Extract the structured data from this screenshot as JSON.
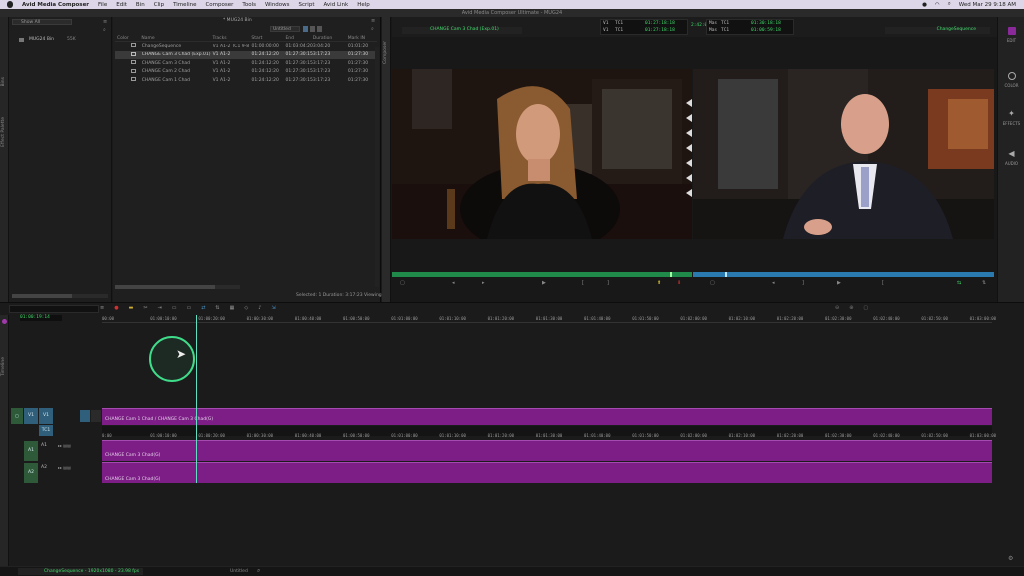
{
  "menubar": {
    "app": "Avid Media Composer",
    "items": [
      "File",
      "Edit",
      "Bin",
      "Clip",
      "Timeline",
      "Composer",
      "Tools",
      "Windows",
      "Script",
      "Avid Link",
      "Help"
    ],
    "clock": "Wed Mar 29  9:18 AM"
  },
  "window_title": "Avid Media Composer Ultimate - MUG24",
  "project": {
    "show_all": "Show All",
    "bin_name": "MUG24 Bin",
    "bin_size": "55K",
    "dock_labels": [
      "Bins",
      "Effect Palette"
    ]
  },
  "bin": {
    "title": "* MUG24 Bin",
    "view": "Untitled",
    "headers": [
      "Color",
      "Name",
      "Tracks",
      "Start",
      "End",
      "Duration",
      "Mark IN"
    ],
    "rows": [
      {
        "name": "ChangeSequence",
        "tracks": "V1 A1-2 TC1 9-8 7C1",
        "start": "01:00:00:00",
        "end": "01:03:04:20",
        "duration": "3:04:20",
        "mark": "01:01:20"
      },
      {
        "name": "CHANGE Cam 3 Chad (Exp.01)",
        "tracks": "V1 A1-2",
        "start": "01:24:12:20",
        "end": "01:27:30:15",
        "duration": "3:17:23",
        "mark": "01:27:30"
      },
      {
        "name": "CHANGE Cam 3 Chad",
        "tracks": "V1 A1-2",
        "start": "01:24:12:20",
        "end": "01:27:30:15",
        "duration": "3:17:23",
        "mark": "01:27:30"
      },
      {
        "name": "CHANGE Cam 2 Chad",
        "tracks": "V1 A1-2",
        "start": "01:24:12:20",
        "end": "01:27:30:15",
        "duration": "3:17:23",
        "mark": "01:27:30"
      },
      {
        "name": "CHANGE Cam 1 Chad",
        "tracks": "V1 A1-2",
        "start": "01:24:12:20",
        "end": "01:27:30:15",
        "duration": "3:17:23",
        "mark": "01:27:30"
      }
    ],
    "status": "Selected: 1  Duration: 3:17:23   Viewing: 5/5"
  },
  "composer": {
    "tab_label": "Composer",
    "source_clip": "CHANGE Cam 3 Chad (Exp.01)",
    "record_clip": "ChangeSequence",
    "tc_rows": [
      {
        "label": "V1",
        "track": "TC1",
        "value": "01:27:18:18"
      },
      {
        "label": "V1",
        "track": "TC1",
        "value": "01:27:18:18"
      }
    ],
    "center_duration": "2:42:08",
    "right_tc_rows": [
      {
        "label": "Mas",
        "track": "TC1",
        "value": "01:30:18:18"
      },
      {
        "label": "Mas",
        "track": "TC1",
        "value": "01:00:59:18"
      }
    ]
  },
  "tools": [
    {
      "icon": "edit-icon",
      "label": "EDIT"
    },
    {
      "icon": "color-icon",
      "label": "COLOR"
    },
    {
      "icon": "effects-icon",
      "label": "EFFECTS"
    },
    {
      "icon": "audio-icon",
      "label": "AUDIO"
    }
  ],
  "timeline": {
    "tab_label": "Timeline",
    "timecode": "01:00:19:14",
    "ruler_top": [
      "00:00",
      "01:00:10:00",
      "01:00:20:00",
      "01:00:30:00",
      "01:00:40:00",
      "01:00:50:00",
      "01:01:00:00",
      "01:01:10:00",
      "01:01:20:00",
      "01:01:30:00",
      "01:01:40:00",
      "01:01:50:00",
      "01:02:00:00",
      "01:02:10:00",
      "01:02:20:00",
      "01:02:30:00",
      "01:02:40:00",
      "01:02:50:00",
      "01:03:00:00"
    ],
    "ruler_mid": [
      "0:00",
      "01:00:10:00",
      "01:00:20:00",
      "01:00:30:00",
      "01:00:40:00",
      "01:00:50:00",
      "01:01:00:00",
      "01:01:10:00",
      "01:01:20:00",
      "01:01:30:00",
      "01:01:40:00",
      "01:01:50:00",
      "01:02:00:00",
      "01:02:10:00",
      "01:02:20:00",
      "01:02:30:00",
      "01:02:40:00",
      "01:02:50:00",
      "01:03:00:00"
    ],
    "tracks": [
      {
        "name": "V1",
        "label": "V1",
        "clip": "CHANGE Cam 1 Chad / CHANGE Cam 3 Chad(G)"
      },
      {
        "name": "TC1",
        "label": "TC1",
        "clip": ""
      },
      {
        "name": "A1",
        "label": "A1",
        "clip": "CHANGE Cam 3 Chad(G)"
      },
      {
        "name": "A2",
        "label": "A2",
        "clip": "CHANGE Cam 3 Chad(G)"
      }
    ],
    "status_left": "ChangeSequence - 1920x1080 - 23.98 fps",
    "status_mid": "Untitled"
  },
  "colors": {
    "clip": "#7c1e86",
    "timecode_green": "#3fdc6b",
    "track_blue": "#2f5f7a",
    "accent_purple": "#8a2a9a"
  }
}
